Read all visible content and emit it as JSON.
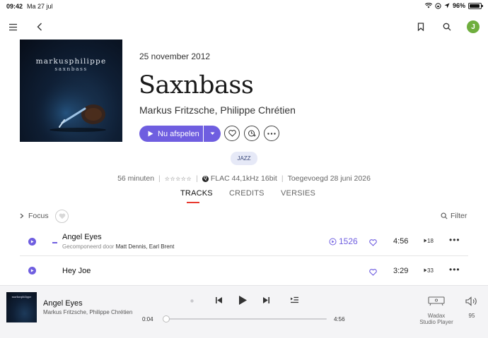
{
  "statusbar": {
    "time": "09:42",
    "date": "Ma 27 jul",
    "battery": "96%",
    "battery_level": 0.96
  },
  "header": {
    "menu_icon": "menu-icon",
    "back_icon": "back-icon",
    "bookmark_icon": "bookmark-icon",
    "search_icon": "search-icon",
    "avatar_initial": "J"
  },
  "album": {
    "cover_text_line1": "markusphilippe",
    "cover_text_line2": "saxnbass",
    "release_date": "25 november 2012",
    "title": "Saxnbass",
    "artists": "Markus Fritzsche, Philippe Chrétien",
    "play_label": "Nu afspelen",
    "genre": "JAZZ",
    "duration": "56 minuten",
    "rating_stars": "☆☆☆☆☆",
    "quality_badge": "Q",
    "quality": "FLAC 44,1kHz 16bit",
    "added": "Toegevoegd 28 juni 2026"
  },
  "tabs": [
    {
      "label": "TRACKS",
      "active": true
    },
    {
      "label": "CREDITS",
      "active": false
    },
    {
      "label": "VERSIES",
      "active": false
    }
  ],
  "toolbar": {
    "focus_label": "Focus",
    "filter_label": "Filter"
  },
  "tracks": [
    {
      "name": "Angel Eyes",
      "composed_prefix": "Gecomponeerd door",
      "composers": "Matt Dennis, Earl Brent",
      "plays": "1526",
      "duration": "4:56",
      "count": "18"
    },
    {
      "name": "Hey Joe",
      "duration": "3:29",
      "count": "33"
    }
  ],
  "player": {
    "title": "Angel Eyes",
    "artist": "Markus Fritzsche, Philippe Chrétien",
    "elapsed": "0:04",
    "total": "4:56",
    "progress": 0.013,
    "device_line1": "Wadax",
    "device_line2": "Studio Player",
    "volume": "95"
  },
  "colors": {
    "accent": "#6f5ee0",
    "tab_underline": "#e8392e",
    "avatar": "#6fae3e"
  }
}
